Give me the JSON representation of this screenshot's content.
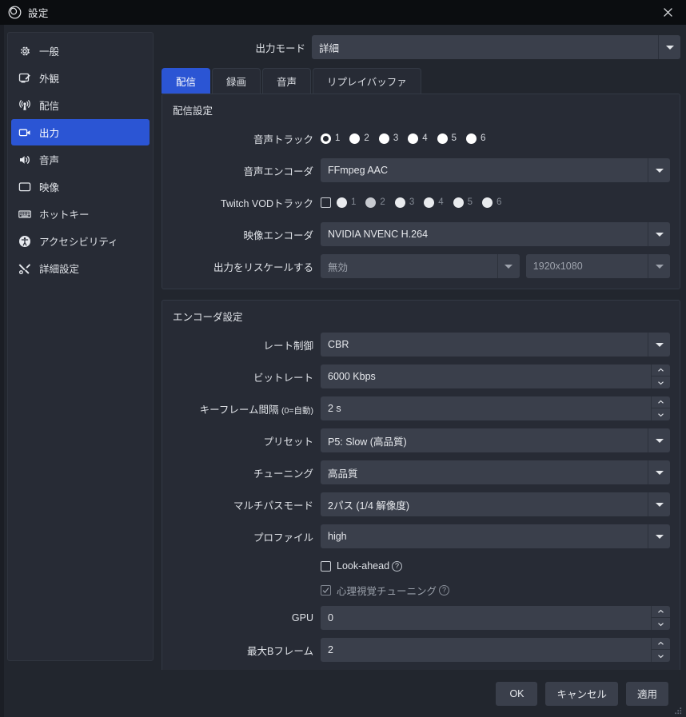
{
  "window": {
    "title": "設定",
    "logo_icon": "obs-logo-icon",
    "close_icon": "close-icon"
  },
  "sidebar": {
    "items": [
      {
        "label": "一般",
        "icon": "gear-icon",
        "active": false
      },
      {
        "label": "外観",
        "icon": "appearance-icon",
        "active": false
      },
      {
        "label": "配信",
        "icon": "broadcast-icon",
        "active": false
      },
      {
        "label": "出力",
        "icon": "output-icon",
        "active": true
      },
      {
        "label": "音声",
        "icon": "speaker-icon",
        "active": false
      },
      {
        "label": "映像",
        "icon": "monitor-icon",
        "active": false
      },
      {
        "label": "ホットキー",
        "icon": "keyboard-icon",
        "active": false
      },
      {
        "label": "アクセシビリティ",
        "icon": "accessibility-icon",
        "active": false
      },
      {
        "label": "詳細設定",
        "icon": "tools-icon",
        "active": false
      }
    ]
  },
  "main": {
    "output_mode": {
      "label": "出力モード",
      "value": "詳細"
    },
    "tabs": [
      {
        "label": "配信",
        "active": true
      },
      {
        "label": "録画",
        "active": false
      },
      {
        "label": "音声",
        "active": false
      },
      {
        "label": "リプレイバッファ",
        "active": false
      }
    ],
    "stream_group": {
      "title": "配信設定",
      "audio_track": {
        "label": "音声トラック",
        "options": [
          "1",
          "2",
          "3",
          "4",
          "5",
          "6"
        ],
        "selected": "1"
      },
      "audio_encoder": {
        "label": "音声エンコーダ",
        "value": "FFmpeg AAC"
      },
      "twitch_vod": {
        "label": "Twitch VODトラック",
        "checked": false,
        "options": [
          "1",
          "2",
          "3",
          "4",
          "5",
          "6"
        ],
        "selected": "2"
      },
      "video_encoder": {
        "label": "映像エンコーダ",
        "value": "NVIDIA NVENC H.264"
      },
      "rescale": {
        "label": "出力をリスケールする",
        "value": "無効",
        "resolution": "1920x1080"
      }
    },
    "encoder_group": {
      "title": "エンコーダ設定",
      "rate_control": {
        "label": "レート制御",
        "value": "CBR"
      },
      "bitrate": {
        "label": "ビットレート",
        "value": "6000 Kbps"
      },
      "keyframe": {
        "label": "キーフレーム間隔 ",
        "label_small": "(0=自動)",
        "value": "2 s"
      },
      "preset": {
        "label": "プリセット",
        "value": "P5: Slow (高品質)"
      },
      "tuning": {
        "label": "チューニング",
        "value": "高品質"
      },
      "multipass": {
        "label": "マルチパスモード",
        "value": "2パス (1/4 解像度)"
      },
      "profile": {
        "label": "プロファイル",
        "value": "high"
      },
      "lookahead": {
        "label": "Look-ahead",
        "checked": false,
        "help_icon": "help-icon"
      },
      "psycho_visual": {
        "label": "心理視覚チューニング",
        "checked": true,
        "help_icon": "help-icon"
      },
      "gpu": {
        "label": "GPU",
        "value": "0"
      },
      "max_bframes": {
        "label": "最大Bフレーム",
        "value": "2"
      }
    }
  },
  "footer": {
    "ok": "OK",
    "cancel": "キャンセル",
    "apply": "適用"
  },
  "colors": {
    "accent": "#2b55d4",
    "window_bg": "#22262e",
    "panel_bg": "#272b35",
    "field_bg": "#3a3f4b",
    "titlebar_bg": "#0b0d10",
    "text": "#dfe2e7",
    "text_dim": "#9aa0aa"
  }
}
